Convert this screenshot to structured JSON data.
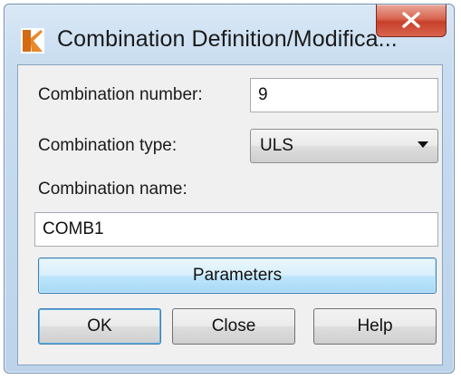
{
  "window": {
    "title": "Combination Definition/Modifica..."
  },
  "form": {
    "number_label": "Combination number:",
    "number_value": "9",
    "type_label": "Combination type:",
    "type_value": "ULS",
    "name_label": "Combination name:",
    "name_value": "COMB1"
  },
  "buttons": {
    "parameters": "Parameters",
    "ok": "OK",
    "close": "Close",
    "help": "Help"
  },
  "icons": {
    "app": "app-logo-icon",
    "close": "close-x-icon",
    "dropdown": "chevron-down-icon"
  },
  "colors": {
    "close_button": "#c7402a",
    "focus_border": "#3c7fb1",
    "app_icon": "#e8892a"
  }
}
